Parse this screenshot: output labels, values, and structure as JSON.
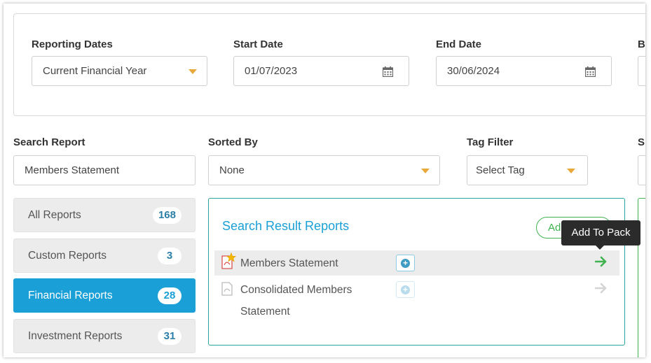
{
  "reporting": {
    "reporting_dates_label": "Reporting Dates",
    "reporting_dates_value": "Current Financial Year",
    "start_date_label": "Start Date",
    "start_date_value": "01/07/2023",
    "end_date_label": "End Date",
    "end_date_value": "30/06/2024",
    "cutoff_label": "B"
  },
  "filters": {
    "search_label": "Search Report",
    "search_value": "Members Statement",
    "sorted_label": "Sorted By",
    "sorted_value": "None",
    "tag_label": "Tag Filter",
    "tag_value": "Select Tag",
    "cutoff_label": "S"
  },
  "sidebar": {
    "items": [
      {
        "label": "All Reports",
        "count": "168"
      },
      {
        "label": "Custom Reports",
        "count": "3"
      },
      {
        "label": "Financial Reports",
        "count": "28"
      },
      {
        "label": "Investment Reports",
        "count": "31"
      }
    ]
  },
  "results": {
    "title": "Search Result Reports",
    "add_button": "Add To Pack",
    "add_button_visible": "Ad",
    "rows": [
      {
        "name": "Members Statement",
        "icon": "pdf-star-icon"
      },
      {
        "name_line1": "Consolidated Members",
        "name_line2": "Statement",
        "icon": "pdf-icon"
      }
    ]
  },
  "tooltip": {
    "text": "Add To Pack"
  },
  "colors": {
    "accent_blue": "#1a9fd6",
    "accent_green": "#3fb34f",
    "caret_orange": "#e8a93a",
    "teal_border": "#2aa6a0"
  }
}
